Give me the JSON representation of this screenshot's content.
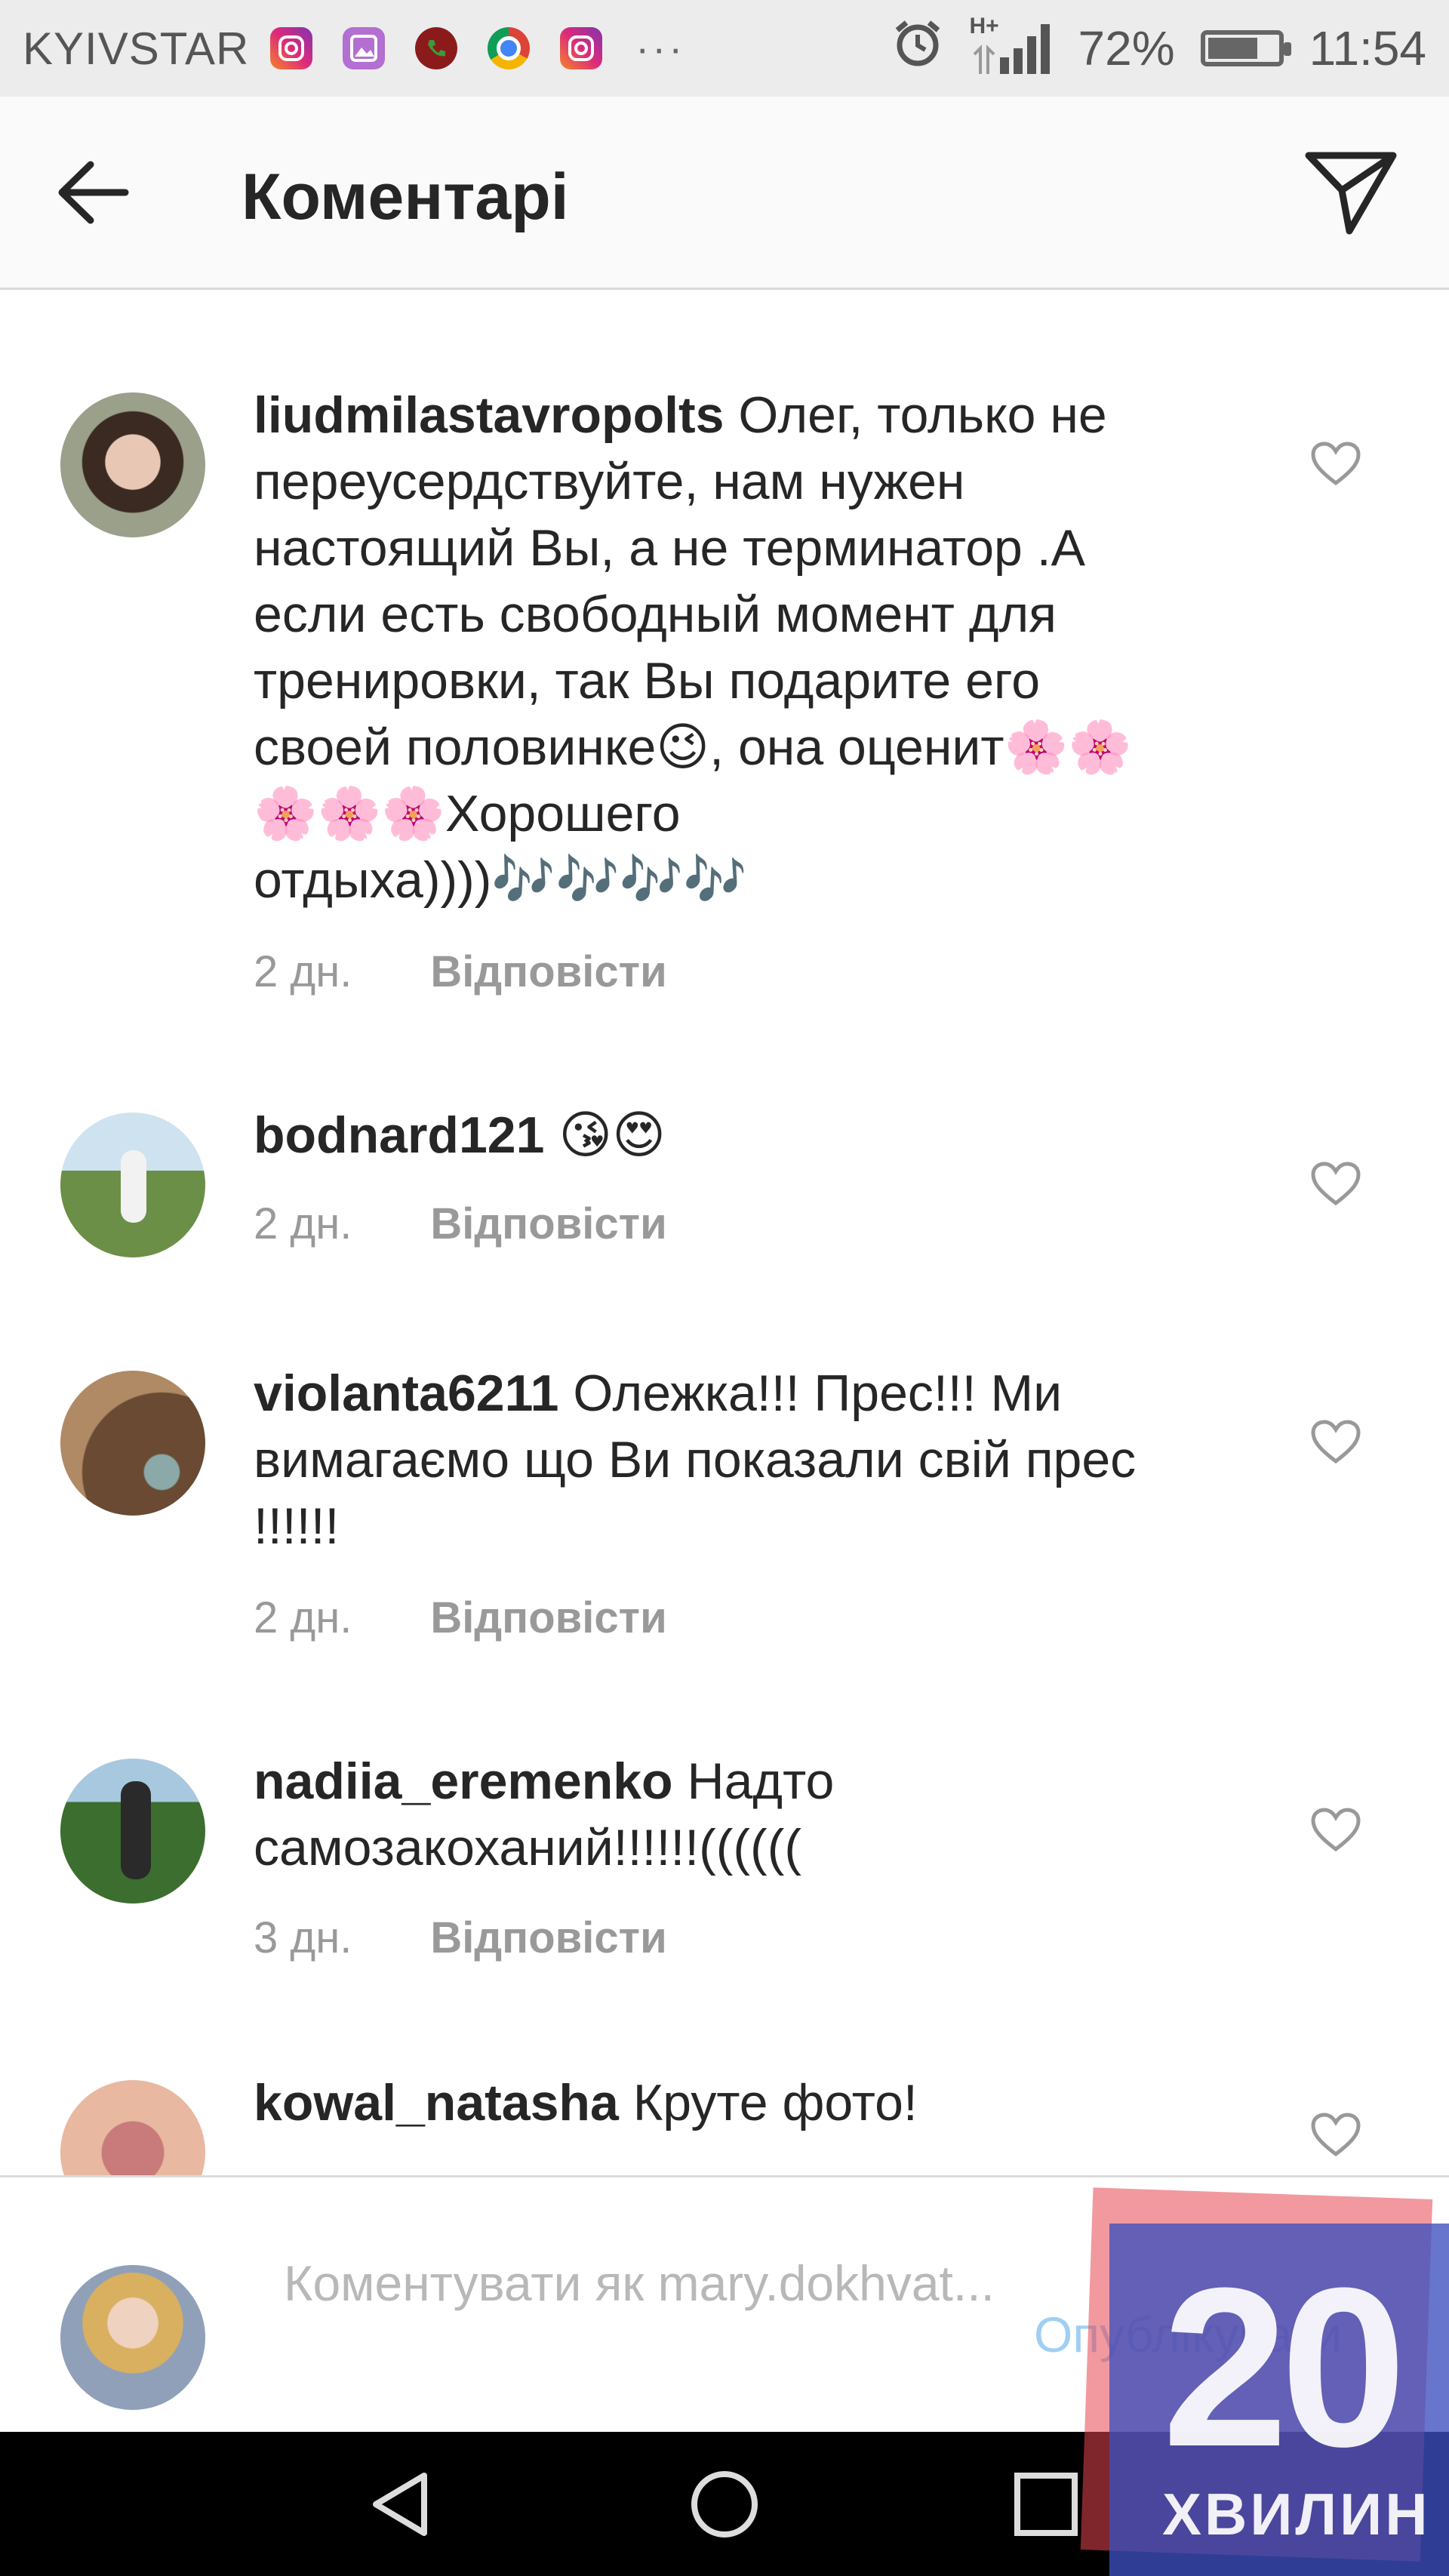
{
  "status_bar": {
    "carrier": "KYIVSTAR",
    "network": "H+",
    "battery": "72%",
    "battery_level": 0.72,
    "time": "11:54",
    "overflow": "···"
  },
  "header": {
    "title": "Коментарі"
  },
  "comments": [
    {
      "username": "liudmilastavropolts",
      "text": "Олег, только не переусердствуйте, нам нужен настоящий Вы, а не терминатор .А если есть свободный момент для тренировки, так Вы подарите его своей половинке😉, она оценит🌸🌸🌸🌸🌸Хорошего отдыха))))🎶🎶🎶🎶",
      "age": "2 дн.",
      "reply": "Відповісти"
    },
    {
      "username": "bodnard121",
      "text": "😘😍",
      "age": "2 дн.",
      "reply": "Відповісти"
    },
    {
      "username": "violanta6211",
      "text": "Олежка!!! Прес!!! Ми вимагаємо що Ви показали свій прес !!!!!!",
      "age": "2 дн.",
      "reply": "Відповісти"
    },
    {
      "username": "nadiia_eremenko",
      "text": "Надто самозакоханий!!!!!!((((((",
      "age": "3 дн.",
      "reply": "Відповісти"
    },
    {
      "username": "kowal_natasha",
      "text": "Круте фото!"
    }
  ],
  "comment_input": {
    "placeholder": "Коментувати як mary.dokhvat...",
    "publish": "Опублікувати"
  },
  "watermark": {
    "number": "20",
    "word": "ХВИЛИН"
  }
}
